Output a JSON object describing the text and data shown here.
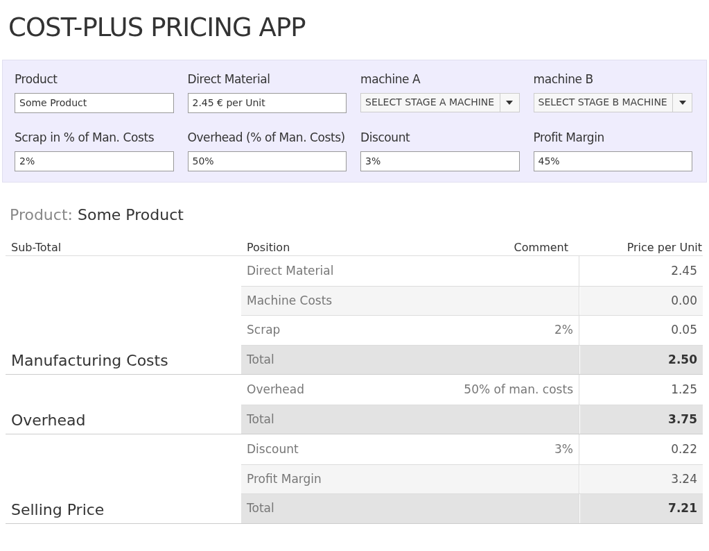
{
  "title": "COST-PLUS PRICING APP",
  "filters": [
    {
      "label": "Product",
      "kind": "text",
      "value": "Some Product"
    },
    {
      "label": "Direct Material",
      "kind": "text",
      "value": "2.45 € per Unit"
    },
    {
      "label": "machine A",
      "kind": "select",
      "value": "SELECT STAGE A MACHINE"
    },
    {
      "label": "machine B",
      "kind": "select",
      "value": "SELECT STAGE B MACHINE"
    },
    {
      "label": "Scrap in % of Man. Costs",
      "kind": "text",
      "value": "2%"
    },
    {
      "label": "Overhead (% of Man. Costs)",
      "kind": "text",
      "value": "50%"
    },
    {
      "label": "Discount",
      "kind": "text",
      "value": "3%"
    },
    {
      "label": "Profit Margin",
      "kind": "text",
      "value": "45%"
    }
  ],
  "product_heading": {
    "label": "Product:",
    "value": "Some Product"
  },
  "table": {
    "columns": [
      "Sub-Total",
      "Position",
      "Comment",
      "Price per Unit"
    ],
    "groups": [
      {
        "label": "Manufacturing Costs",
        "rows": [
          {
            "kind": "plain",
            "position": "Direct Material",
            "price": "2.45"
          },
          {
            "kind": "shaded",
            "position": "Machine Costs",
            "price": "0.00"
          },
          {
            "kind": "plain",
            "position": "Scrap",
            "comment": "2%",
            "price": "0.05"
          },
          {
            "kind": "total",
            "position": "Total",
            "price": "2.50"
          }
        ]
      },
      {
        "label": "Overhead",
        "rows": [
          {
            "kind": "plain",
            "position": "Overhead",
            "comment": "50% of man. costs",
            "price": "1.25"
          },
          {
            "kind": "total",
            "position": "Total",
            "price": "3.75"
          }
        ]
      },
      {
        "label": "Selling Price",
        "rows": [
          {
            "kind": "plain",
            "position": "Discount",
            "comment": "3%",
            "price": "0.22"
          },
          {
            "kind": "shaded",
            "position": "Profit Margin",
            "price": "3.24"
          },
          {
            "kind": "total",
            "position": "Total",
            "price": "7.21"
          }
        ]
      }
    ]
  }
}
